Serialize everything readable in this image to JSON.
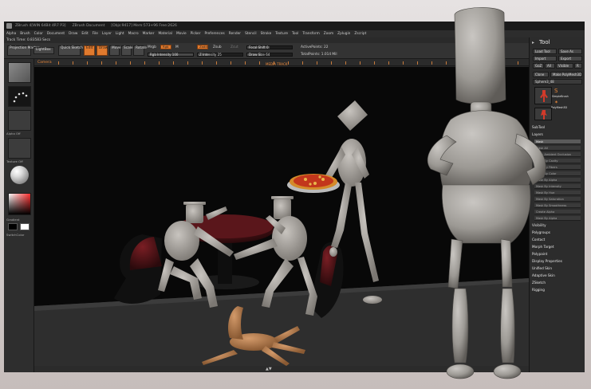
{
  "window": {
    "title": "ZBrush 4[WIN 64Bit 4R7 P3]",
    "document": "ZBrush Document",
    "info": "[Objs:9417] Mem:573+96 Free:2626"
  },
  "menu": [
    "Alpha",
    "Brush",
    "Color",
    "Document",
    "Draw",
    "Edit",
    "File",
    "Layer",
    "Light",
    "Macro",
    "Marker",
    "Material",
    "Movie",
    "Picker",
    "Preferences",
    "Render",
    "Stencil",
    "Stroke",
    "Texture",
    "Tool",
    "Transform",
    "Zoom",
    "Zplugin",
    "Zscript"
  ],
  "track": "Track Time: 0.83583 Secs",
  "toolbar": {
    "projection": "Projection Master",
    "lightbox": "LightBox",
    "quicksketch": "Quick Sketch",
    "edit": "Edit",
    "draw": "Draw",
    "move": "Move",
    "scale": "Scale",
    "rotate": "Rotate",
    "mrgb": "Mrgb",
    "rgb": "Rgb",
    "m": "M",
    "zadd": "Zadd",
    "zsub": "Zsub",
    "zcut": "Zcut",
    "rgb_intensity": "Rgb Intensity 100",
    "z_intensity": "Z Intensity 25",
    "focal": "Focal Shift 0",
    "drawsize": "Draw Size 64",
    "active_points": "ActivePoints: 22",
    "total_points": "TotalPoints: 1.014 Mil"
  },
  "ruler": {
    "camera": "Camera",
    "mid": "MEDIA TRACK"
  },
  "lefttray": {
    "labels": [
      "",
      "",
      "Alpha Off",
      "Texture Off",
      "Material",
      "Gradient",
      "SwitchColor"
    ]
  },
  "rightpanel": {
    "title": "Tool",
    "buttons": [
      [
        "Load Tool",
        "Save As"
      ],
      [
        "Import",
        "Export"
      ],
      [
        "GoZ",
        "All",
        "Visible",
        "R"
      ]
    ],
    "clone": "Clone",
    "make": "Make PolyMesh3D",
    "mesh": "Sphere3_48",
    "mesh_num": "48",
    "thumbs": [
      "Sphere3",
      "SimpleBrush",
      "PolyMesh3D"
    ],
    "sections_top": [
      "SubTool",
      "Layers"
    ],
    "subtool_items": [
      "Mask",
      "Mask All",
      "Mask Ambient Occlusion",
      "Mask By Cavity",
      "Mask By Fibers",
      "Mask By Color",
      "Mask By Alpha",
      "Mask By Intensity",
      "Mask By Hue",
      "Mask By Saturation",
      "Mask By Smoothness",
      "Create Alpha",
      "Mask By Alpha"
    ],
    "sections": [
      "Visibility",
      "Polygroups",
      "Contact",
      "Morph Target",
      "Polypaint",
      "Display Properties",
      "Unified Skin",
      "Adaptive Skin",
      "ZSketch",
      "Rigging"
    ]
  },
  "colors": {
    "accent": "#e07a2e",
    "background": "#262626",
    "canvas": "#080808",
    "mannequin": "#a6a29d",
    "chair": "#4a1418"
  }
}
